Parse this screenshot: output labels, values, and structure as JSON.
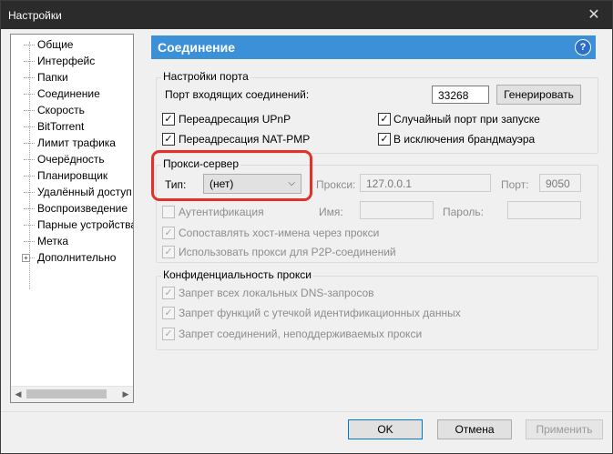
{
  "window": {
    "title": "Настройки"
  },
  "tree": {
    "items": [
      {
        "label": "Общие"
      },
      {
        "label": "Интерфейс"
      },
      {
        "label": "Папки"
      },
      {
        "label": "Соединение"
      },
      {
        "label": "Скорость"
      },
      {
        "label": "BitTorrent"
      },
      {
        "label": "Лимит трафика"
      },
      {
        "label": "Очерёдность"
      },
      {
        "label": "Планировщик"
      },
      {
        "label": "Удалённый доступ"
      },
      {
        "label": "Воспроизведение"
      },
      {
        "label": "Парные устройства"
      },
      {
        "label": "Метка"
      },
      {
        "label": "Дополнительно"
      }
    ],
    "expand_symbol": "+"
  },
  "panel": {
    "title": "Соединение",
    "help": "?"
  },
  "port": {
    "group_title": "Настройки порта",
    "incoming_label": "Порт входящих соединений:",
    "incoming_value": "33268",
    "generate_button": "Генерировать",
    "upnp_label": "Переадресация UPnP",
    "natpmp_label": "Переадресация NAT-PMP",
    "random_label": "Случайный порт при запуске",
    "firewall_label": "В исключения брандмауэра",
    "checkmark": "✓"
  },
  "proxy": {
    "group_title": "Прокси-сервер",
    "type_label": "Тип:",
    "type_value": "(нет)",
    "proxy_label": "Прокси:",
    "proxy_value": "127.0.0.1",
    "port_label": "Порт:",
    "port_value": "9050",
    "auth_label": "Аутентификация",
    "name_label": "Имя:",
    "password_label": "Пароль:",
    "resolve_label": "Сопоставлять хост-имена через прокси",
    "p2p_label": "Использовать прокси для P2P-соединений"
  },
  "privacy": {
    "group_title": "Конфиденциальность прокси",
    "dns_label": "Запрет всех локальных DNS-запросов",
    "leak_label": "Запрет функций с утечкой идентификационных данных",
    "unsupported_label": "Запрет соединений, неподдерживаемых прокси"
  },
  "buttons": {
    "ok": "OK",
    "cancel": "Отмена",
    "apply": "Применить"
  },
  "colors": {
    "header": "#3c90d8",
    "highlight": "#e0312a",
    "titlebar": "#2b2b2b"
  }
}
